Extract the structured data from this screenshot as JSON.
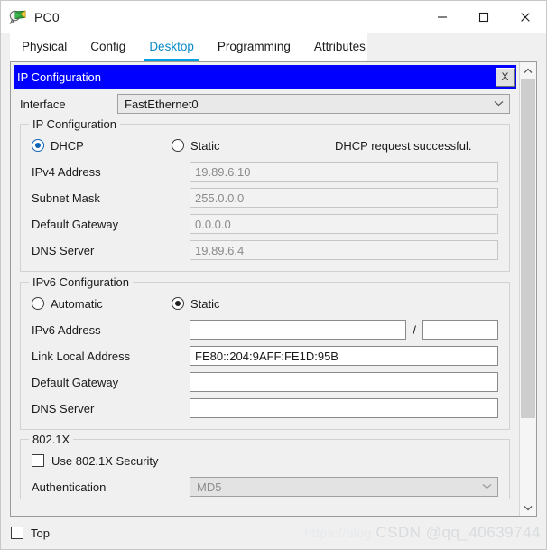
{
  "window": {
    "title": "PC0",
    "icon": "packet-tracer-pc-icon",
    "minimize_label": "—",
    "maximize_label": "□",
    "close_label": "✕"
  },
  "tabs": [
    {
      "label": "Physical",
      "active": false
    },
    {
      "label": "Config",
      "active": false
    },
    {
      "label": "Desktop",
      "active": true
    },
    {
      "label": "Programming",
      "active": false
    },
    {
      "label": "Attributes",
      "active": false
    }
  ],
  "dialog": {
    "title": "IP Configuration",
    "close_label": "X",
    "title_bg": "#0000ff",
    "title_fg": "#ffffff"
  },
  "interface": {
    "label": "Interface",
    "value": "FastEthernet0",
    "chevron": "⌄"
  },
  "ipv4": {
    "legend": "IP Configuration",
    "mode_dhcp": {
      "label": "DHCP",
      "selected": true
    },
    "mode_static": {
      "label": "Static",
      "selected": false
    },
    "status": "DHCP request successful.",
    "fields": [
      {
        "label": "IPv4 Address",
        "value": "19.89.6.10",
        "enabled": false
      },
      {
        "label": "Subnet Mask",
        "value": "255.0.0.0",
        "enabled": false
      },
      {
        "label": "Default Gateway",
        "value": "0.0.0.0",
        "enabled": false
      },
      {
        "label": "DNS Server",
        "value": "19.89.6.4",
        "enabled": false
      }
    ]
  },
  "ipv6": {
    "legend": "IPv6 Configuration",
    "mode_automatic": {
      "label": "Automatic",
      "selected": false
    },
    "mode_static": {
      "label": "Static",
      "selected": true
    },
    "address": {
      "label": "IPv6 Address",
      "value": "",
      "prefix": "",
      "separator": "/"
    },
    "fields": [
      {
        "label": "Link Local Address",
        "value": "FE80::204:9AFF:FE1D:95B",
        "enabled": true
      },
      {
        "label": "Default Gateway",
        "value": "",
        "enabled": true
      },
      {
        "label": "DNS Server",
        "value": "",
        "enabled": true
      }
    ]
  },
  "dot1x": {
    "legend": "802.1X",
    "use_security": {
      "label": "Use 802.1X Security",
      "checked": false
    },
    "authentication": {
      "label": "Authentication",
      "value": "MD5",
      "chevron": "⌄"
    }
  },
  "scrollbar": {
    "up_arrow": "∧",
    "down_arrow": "∨"
  },
  "bottom": {
    "top_checkbox": {
      "label": "Top",
      "checked": false
    },
    "watermark_url": "https://blog.",
    "watermark_text": "CSDN @qq_40639744"
  }
}
